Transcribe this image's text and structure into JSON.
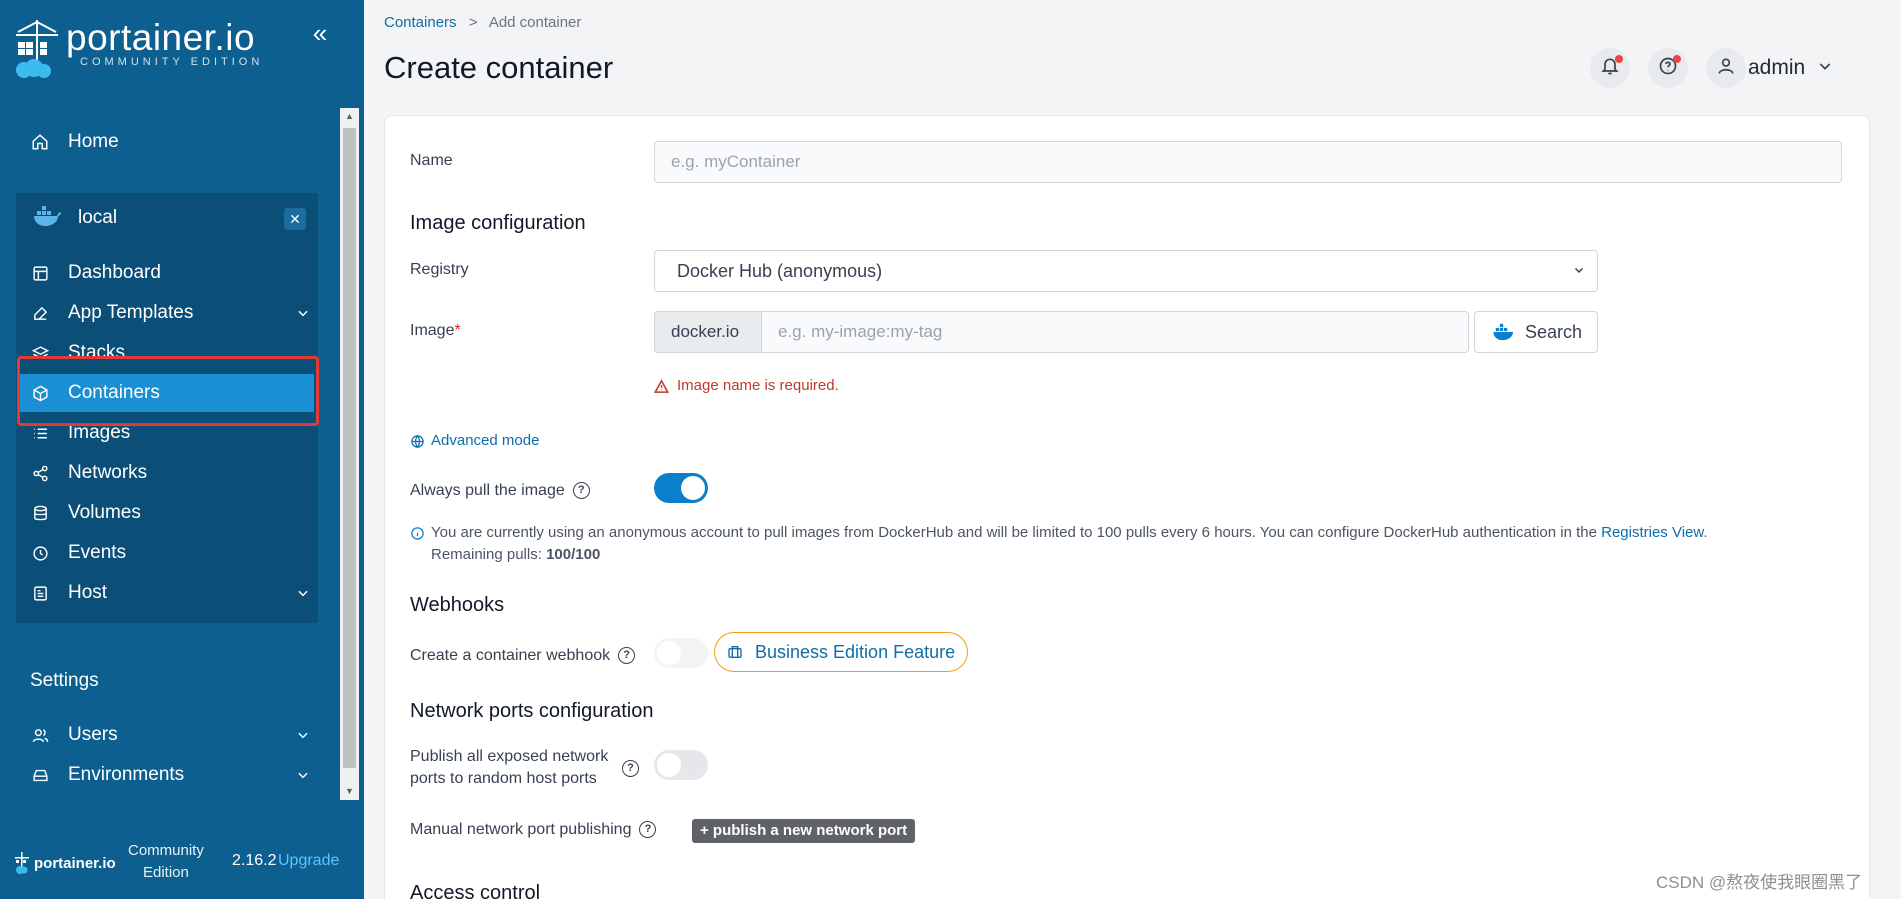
{
  "sidebar": {
    "logo_name": "portainer.io",
    "logo_sub": "COMMUNITY EDITION",
    "home_label": "Home",
    "environment": {
      "name": "local"
    },
    "env_items": [
      {
        "label": "Dashboard"
      },
      {
        "label": "App Templates"
      },
      {
        "label": "Stacks"
      },
      {
        "label": "Containers"
      },
      {
        "label": "Images"
      },
      {
        "label": "Networks"
      },
      {
        "label": "Volumes"
      },
      {
        "label": "Events"
      },
      {
        "label": "Host"
      }
    ],
    "settings_label": "Settings",
    "settings_items": [
      {
        "label": "Users"
      },
      {
        "label": "Environments"
      }
    ],
    "footer": {
      "logo_text": "portainer.io",
      "edition_line1": "Community",
      "edition_line2": "Edition",
      "version": "2.16.2",
      "upgrade": "Upgrade"
    }
  },
  "header": {
    "breadcrumb_link": "Containers",
    "breadcrumb_sep": ">",
    "breadcrumb_current": "Add container",
    "title": "Create container",
    "user": "admin"
  },
  "form": {
    "name_label": "Name",
    "name_placeholder": "e.g. myContainer",
    "image_config_title": "Image configuration",
    "registry_label": "Registry",
    "registry_value": "Docker Hub (anonymous)",
    "image_label": "Image",
    "image_required_mark": "*",
    "image_prefix": "docker.io",
    "image_placeholder": "e.g. my-image:my-tag",
    "search_button": "Search",
    "image_error": "Image name is required.",
    "advanced_mode": "Advanced mode",
    "always_pull_label": "Always pull the image",
    "always_pull_on": true,
    "info_text": "You are currently using an anonymous account to pull images from DockerHub and will be limited to 100 pulls every 6 hours. You can configure DockerHub authentication in the",
    "info_link": "Registries View.",
    "remaining_label": "Remaining pulls:",
    "remaining_value": "100/100",
    "webhooks_title": "Webhooks",
    "webhook_label": "Create a container webhook",
    "be_feature": "Business Edition Feature",
    "network_title": "Network ports configuration",
    "publish_all_line1": "Publish all exposed network",
    "publish_all_line2": "ports to random host ports",
    "manual_publish_label": "Manual network port publishing",
    "publish_new_button": "+ publish a new network port",
    "access_control_title": "Access control"
  },
  "watermark": "CSDN @熬夜使我眼圈黑了",
  "colors": {
    "sidebar_bg": "#0d5f8f",
    "active_item": "#1a8fd4",
    "accent": "#0b7fcb",
    "error": "#c0392b",
    "highlight_border": "#e53935"
  }
}
